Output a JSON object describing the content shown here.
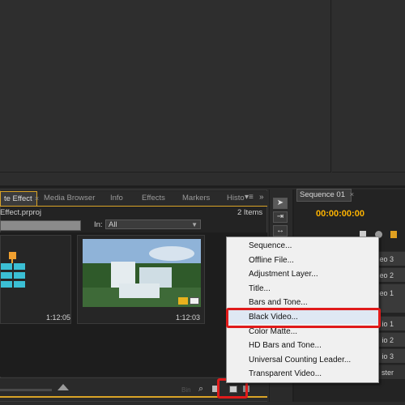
{
  "project_panel": {
    "tabs": [
      {
        "label": "te Effect",
        "active": true
      },
      {
        "label": "Media Browser"
      },
      {
        "label": "Info"
      },
      {
        "label": "Effects"
      },
      {
        "label": "Markers"
      },
      {
        "label": "Histo"
      }
    ],
    "project_name": "Effect.prproj",
    "item_count": "2 Items",
    "in_label": "In:",
    "in_value": "All",
    "items": [
      {
        "type": "sequence",
        "duration": "1:12:05"
      },
      {
        "type": "clip",
        "duration": "1:12:03"
      }
    ]
  },
  "sequence_panel": {
    "tab_label": "Sequence 01",
    "timecode": "00:00:00:00",
    "tracks": [
      "eo 3",
      "eo 2",
      "eo 1",
      "io 1",
      "io 2",
      "io 3",
      "ster"
    ]
  },
  "context_menu": {
    "items": [
      "Sequence...",
      "Offline File...",
      "Adjustment Layer...",
      "Title...",
      "Bars and Tone...",
      "Black Video...",
      "Color Matte...",
      "HD Bars and Tone...",
      "Universal Counting Leader...",
      "Transparent Video..."
    ],
    "highlighted": "Black Video..."
  },
  "colors": {
    "accent": "#d9a327",
    "timecode": "#ffb400",
    "highlight_box": "#e01b1b"
  }
}
